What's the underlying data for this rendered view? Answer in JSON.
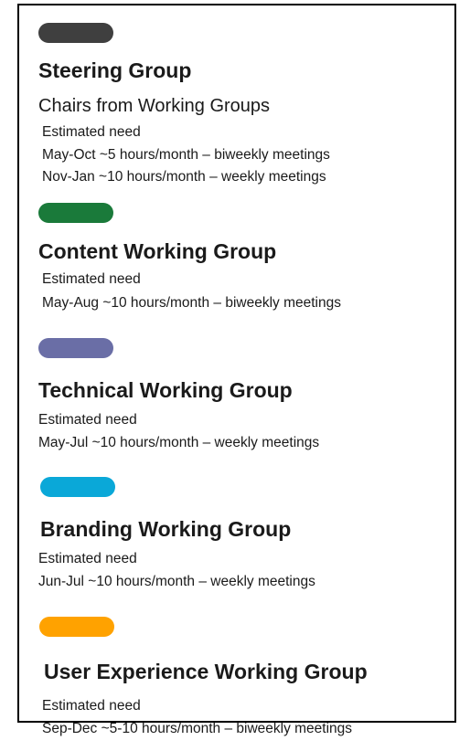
{
  "groups": [
    {
      "color": "#3f3f3f",
      "title": "Steering Group",
      "subtitle": "Chairs from Working Groups",
      "label": "Estimated need",
      "lines": [
        "May-Oct ~5 hours/month – biweekly meetings",
        "Nov-Jan ~10 hours/month – weekly meetings"
      ]
    },
    {
      "color": "#1a7a3a",
      "title": "Content Working Group",
      "label": "Estimated need",
      "lines": [
        "May-Aug ~10 hours/month – biweekly meetings"
      ]
    },
    {
      "color": "#6a6ea6",
      "title": "Technical Working Group",
      "label": "Estimated need",
      "lines": [
        "May-Jul ~10 hours/month – weekly meetings"
      ]
    },
    {
      "color": "#0aa8d8",
      "title": "Branding Working Group",
      "label": "Estimated need",
      "lines": [
        "Jun-Jul ~10 hours/month – weekly meetings"
      ]
    },
    {
      "color": "#ffa200",
      "title": "User Experience Working Group",
      "label": "Estimated need",
      "lines": [
        "Sep-Dec ~5-10 hours/month – biweekly meetings"
      ]
    }
  ]
}
